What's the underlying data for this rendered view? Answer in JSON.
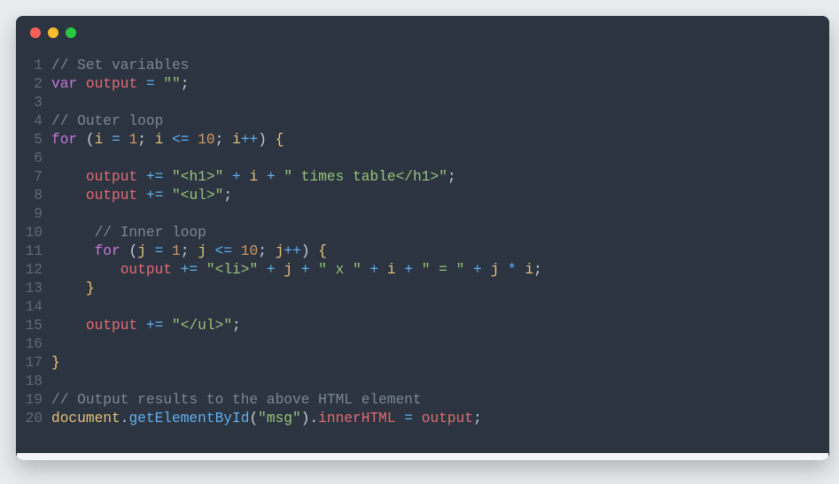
{
  "window": {
    "controls": [
      "close",
      "minimize",
      "zoom"
    ]
  },
  "code": {
    "lines": [
      {
        "n": 1,
        "tokens": [
          [
            "cm",
            "// Set variables"
          ]
        ]
      },
      {
        "n": 2,
        "tokens": [
          [
            "kw",
            "var"
          ],
          [
            "p",
            " "
          ],
          [
            "vr",
            "output"
          ],
          [
            "p",
            " "
          ],
          [
            "op",
            "="
          ],
          [
            "p",
            " "
          ],
          [
            "str",
            "\"\""
          ],
          [
            "p",
            ";"
          ]
        ]
      },
      {
        "n": 3,
        "tokens": []
      },
      {
        "n": 4,
        "tokens": [
          [
            "cm",
            "// Outer loop"
          ]
        ]
      },
      {
        "n": 5,
        "tokens": [
          [
            "kw",
            "for"
          ],
          [
            "p",
            " "
          ],
          [
            "p",
            "("
          ],
          [
            "id",
            "i"
          ],
          [
            "p",
            " "
          ],
          [
            "op",
            "="
          ],
          [
            "p",
            " "
          ],
          [
            "num",
            "1"
          ],
          [
            "p",
            "; "
          ],
          [
            "id",
            "i"
          ],
          [
            "p",
            " "
          ],
          [
            "op",
            "<="
          ],
          [
            "p",
            " "
          ],
          [
            "num",
            "10"
          ],
          [
            "p",
            "; "
          ],
          [
            "id",
            "i"
          ],
          [
            "op",
            "++"
          ],
          [
            "p",
            ") "
          ],
          [
            "brc",
            "{"
          ]
        ]
      },
      {
        "n": 6,
        "tokens": []
      },
      {
        "n": 7,
        "tokens": [
          [
            "p",
            "    "
          ],
          [
            "vr",
            "output"
          ],
          [
            "p",
            " "
          ],
          [
            "op",
            "+="
          ],
          [
            "p",
            " "
          ],
          [
            "str",
            "\"<h1>\""
          ],
          [
            "p",
            " "
          ],
          [
            "op",
            "+"
          ],
          [
            "p",
            " "
          ],
          [
            "id",
            "i"
          ],
          [
            "p",
            " "
          ],
          [
            "op",
            "+"
          ],
          [
            "p",
            " "
          ],
          [
            "str",
            "\" times table</h1>\""
          ],
          [
            "p",
            ";"
          ]
        ]
      },
      {
        "n": 8,
        "tokens": [
          [
            "p",
            "    "
          ],
          [
            "vr",
            "output"
          ],
          [
            "p",
            " "
          ],
          [
            "op",
            "+="
          ],
          [
            "p",
            " "
          ],
          [
            "str",
            "\"<ul>\""
          ],
          [
            "p",
            ";"
          ]
        ]
      },
      {
        "n": 9,
        "tokens": []
      },
      {
        "n": 10,
        "tokens": [
          [
            "p",
            "     "
          ],
          [
            "cm",
            "// Inner loop"
          ]
        ]
      },
      {
        "n": 11,
        "tokens": [
          [
            "p",
            "     "
          ],
          [
            "kw",
            "for"
          ],
          [
            "p",
            " "
          ],
          [
            "p",
            "("
          ],
          [
            "id",
            "j"
          ],
          [
            "p",
            " "
          ],
          [
            "op",
            "="
          ],
          [
            "p",
            " "
          ],
          [
            "num",
            "1"
          ],
          [
            "p",
            "; "
          ],
          [
            "id",
            "j"
          ],
          [
            "p",
            " "
          ],
          [
            "op",
            "<="
          ],
          [
            "p",
            " "
          ],
          [
            "num",
            "10"
          ],
          [
            "p",
            "; "
          ],
          [
            "id",
            "j"
          ],
          [
            "op",
            "++"
          ],
          [
            "p",
            ") "
          ],
          [
            "brc",
            "{"
          ]
        ]
      },
      {
        "n": 12,
        "tokens": [
          [
            "p",
            "        "
          ],
          [
            "vr",
            "output"
          ],
          [
            "p",
            " "
          ],
          [
            "op",
            "+="
          ],
          [
            "p",
            " "
          ],
          [
            "str",
            "\"<li>\""
          ],
          [
            "p",
            " "
          ],
          [
            "op",
            "+"
          ],
          [
            "p",
            " "
          ],
          [
            "id",
            "j"
          ],
          [
            "p",
            " "
          ],
          [
            "op",
            "+"
          ],
          [
            "p",
            " "
          ],
          [
            "str",
            "\" x \""
          ],
          [
            "p",
            " "
          ],
          [
            "op",
            "+"
          ],
          [
            "p",
            " "
          ],
          [
            "id",
            "i"
          ],
          [
            "p",
            " "
          ],
          [
            "op",
            "+"
          ],
          [
            "p",
            " "
          ],
          [
            "str",
            "\" = \""
          ],
          [
            "p",
            " "
          ],
          [
            "op",
            "+"
          ],
          [
            "p",
            " "
          ],
          [
            "id",
            "j"
          ],
          [
            "p",
            " "
          ],
          [
            "op",
            "*"
          ],
          [
            "p",
            " "
          ],
          [
            "id",
            "i"
          ],
          [
            "p",
            ";"
          ]
        ]
      },
      {
        "n": 13,
        "tokens": [
          [
            "p",
            "    "
          ],
          [
            "brc",
            "}"
          ]
        ]
      },
      {
        "n": 14,
        "tokens": []
      },
      {
        "n": 15,
        "tokens": [
          [
            "p",
            "    "
          ],
          [
            "vr",
            "output"
          ],
          [
            "p",
            " "
          ],
          [
            "op",
            "+="
          ],
          [
            "p",
            " "
          ],
          [
            "str",
            "\"</ul>\""
          ],
          [
            "p",
            ";"
          ]
        ]
      },
      {
        "n": 16,
        "tokens": []
      },
      {
        "n": 17,
        "tokens": [
          [
            "brc",
            "}"
          ]
        ]
      },
      {
        "n": 18,
        "tokens": []
      },
      {
        "n": 19,
        "tokens": [
          [
            "cm",
            "// Output results to the above HTML element"
          ]
        ]
      },
      {
        "n": 20,
        "tokens": [
          [
            "obj",
            "document"
          ],
          [
            "p",
            "."
          ],
          [
            "fn",
            "getElementById"
          ],
          [
            "p",
            "("
          ],
          [
            "str",
            "\"msg\""
          ],
          [
            "p",
            ")"
          ],
          [
            "p",
            "."
          ],
          [
            "prop",
            "innerHTML"
          ],
          [
            "p",
            " "
          ],
          [
            "op",
            "="
          ],
          [
            "p",
            " "
          ],
          [
            "vr",
            "output"
          ],
          [
            "p",
            ";"
          ]
        ]
      }
    ]
  }
}
